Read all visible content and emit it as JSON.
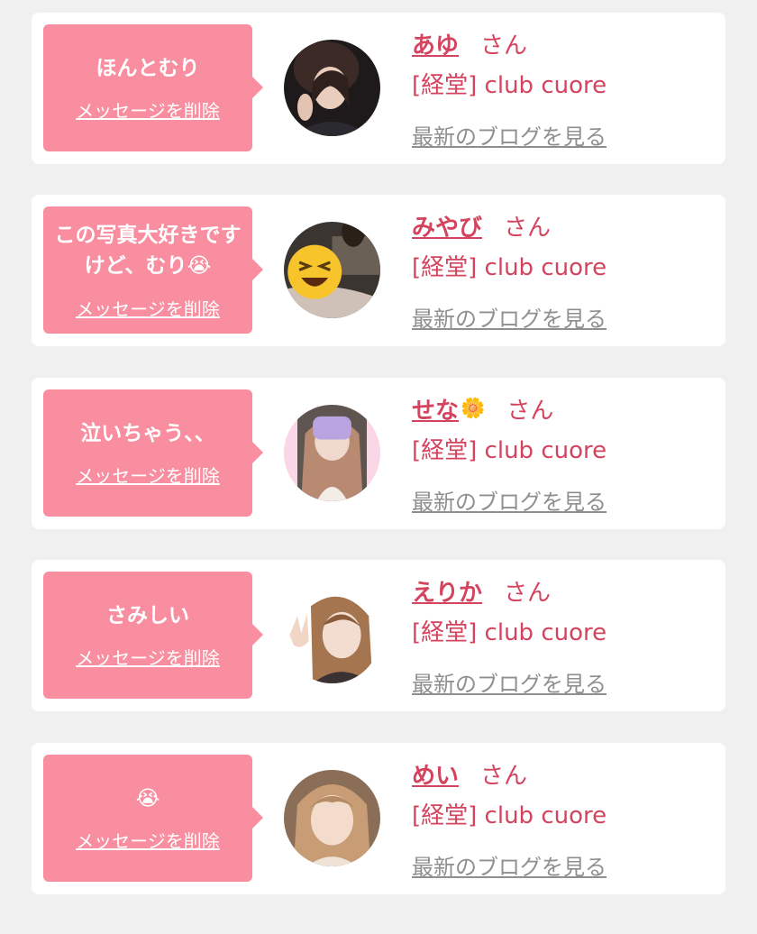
{
  "colors": {
    "accent": "#d4445f",
    "bubble": "#f88e9f",
    "link_gray": "#8f8f8f"
  },
  "suffix": "さん",
  "shop": "[経堂] club cuore",
  "blog_link": "最新のブログを見る",
  "delete_link": "メッセージを削除",
  "items": [
    {
      "name": "あゆ",
      "message": "ほんとむり",
      "avatar": "photo"
    },
    {
      "name": "みやび",
      "message": "この写真大好きですけど、むり😭",
      "avatar": "laughing-emoji-photo"
    },
    {
      "name": "せな",
      "name_icon": "🌼",
      "message": "泣いちゃう、、",
      "avatar": "photo"
    },
    {
      "name": "えりか",
      "message": "さみしい",
      "avatar": "photo"
    },
    {
      "name": "めい",
      "message": "😭",
      "avatar": "photo"
    }
  ]
}
